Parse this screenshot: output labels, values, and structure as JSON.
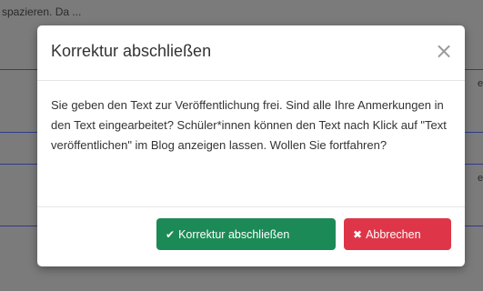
{
  "background": {
    "text": "spazieren. Da ...",
    "edge_fragments": [
      "en",
      "en"
    ]
  },
  "modal": {
    "title": "Korrektur abschließen",
    "close_icon": "×",
    "body": "Sie geben den Text zur Veröffentlichung frei. Sind alle Ihre Anmerkungen in den Text eingearbeitet? Schüler*innen können den Text nach Klick auf \"Text veröffentlichen\" im Blog anzeigen lassen. Wollen Sie fortfahren?",
    "confirm_icon": "✔",
    "confirm_label": "Korrektur abschließen",
    "cancel_icon": "✖",
    "cancel_label": "Abbrechen"
  },
  "colors": {
    "confirm": "#1c8a57",
    "cancel": "#de3648",
    "backdrop": "#7b7b7b"
  }
}
